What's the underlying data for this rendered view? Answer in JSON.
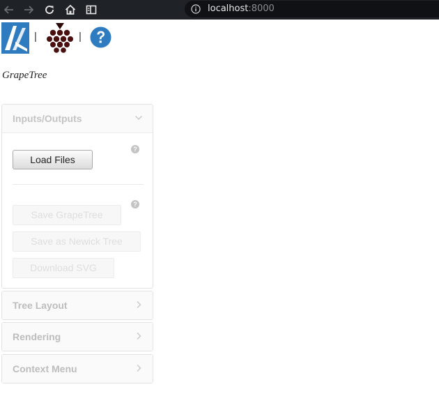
{
  "browser": {
    "url_host": "localhost",
    "url_port": ":8000",
    "icons": [
      "back-arrow-icon",
      "forward-arrow-icon",
      "reload-icon",
      "home-icon",
      "reader-mode-icon",
      "info-icon"
    ]
  },
  "header": {
    "separator": "|",
    "title": "GrapeTree",
    "icons": [
      "enterobase-logo",
      "grape-logo",
      "help-icon"
    ]
  },
  "panels": {
    "io": {
      "title": "Inputs/Outputs",
      "help_glyph": "?",
      "load_label": "Load Files",
      "save_label": "Save GrapeTree",
      "newick_label": "Save as Newick Tree",
      "svg_label": "Download SVG"
    },
    "tree_layout": {
      "title": "Tree Layout"
    },
    "rendering": {
      "title": "Rendering"
    },
    "context_menu": {
      "title": "Context Menu"
    }
  },
  "colors": {
    "browser_bar": "#1f2227",
    "accent_blue": "#2e7bbf",
    "grape": "#4a0f0f"
  }
}
